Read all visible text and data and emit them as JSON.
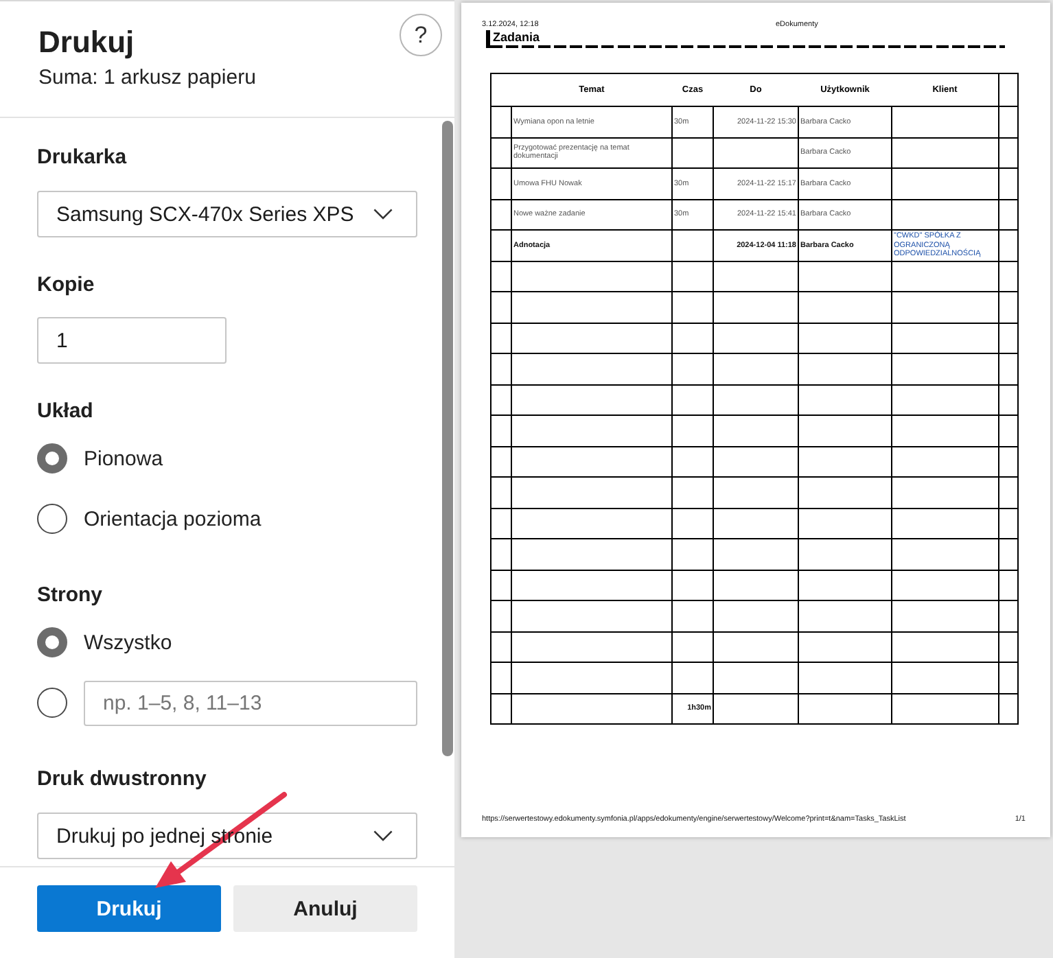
{
  "dialog": {
    "title": "Drukuj",
    "summary": "Suma: 1 arkusz papieru",
    "help_button": "?"
  },
  "settings": [
    {
      "kind": "select",
      "label": "Drukarka",
      "value": "Samsung SCX-470x Series XPS"
    },
    {
      "kind": "input",
      "label": "Kopie",
      "value": "1"
    },
    {
      "kind": "radio",
      "label": "Układ",
      "options": [
        {
          "label": "Pionowa",
          "selected": true
        },
        {
          "label": "Orientacja pozioma",
          "selected": false
        }
      ]
    },
    {
      "kind": "radio",
      "label": "Strony",
      "options": [
        {
          "label": "Wszystko",
          "selected": true
        },
        {
          "placeholder": "np. 1–5, 8, 11–13",
          "selected": false
        }
      ]
    },
    {
      "kind": "select",
      "label": "Druk dwustronny",
      "value": "Drukuj po jednej stronie"
    }
  ],
  "buttons": [
    {
      "label": "Drukuj",
      "primary": true
    },
    {
      "label": "Anuluj",
      "primary": false
    }
  ],
  "preview": {
    "date": "3.12.2024, 12:18",
    "site": "eDokumenty",
    "heading": "Zadania",
    "columns": [
      "Temat",
      "Czas",
      "Do",
      "Użytkownik",
      "Klient"
    ],
    "rows": [
      {
        "temat": "Wymiana opon na letnie",
        "czas": "30m",
        "do": "2024-11-22 15:30",
        "uzytkownik": "Barbara Cacko",
        "bold": false
      },
      {
        "temat": "Przygotować prezentację na temat dokumentacji",
        "uzytkownik": "Barbara Cacko",
        "bold": false
      },
      {
        "temat": "Umowa FHU Nowak",
        "czas": "30m",
        "do": "2024-11-22 15:17",
        "uzytkownik": "Barbara Cacko",
        "bold": false
      },
      {
        "temat": "Nowe ważne zadanie",
        "czas": "30m",
        "do": "2024-11-22 15:41",
        "uzytkownik": "Barbara Cacko",
        "bold": false
      },
      {
        "temat": "Adnotacja",
        "do": "2024-12-04 11:18",
        "uzytkownik": "Barbara Cacko",
        "klient": "\"CWKD\" SPÓŁKA Z OGRANICZONĄ ODPOWIEDZIALNOŚCIĄ",
        "bold": true
      }
    ],
    "total_time": "1h30m",
    "url": "https://serwertestowy.edokumenty.symfonia.pl/apps/edokumenty/engine/serwertestowy/Welcome?print=t&nam=Tasks_TaskList",
    "page_number": "1/1"
  }
}
